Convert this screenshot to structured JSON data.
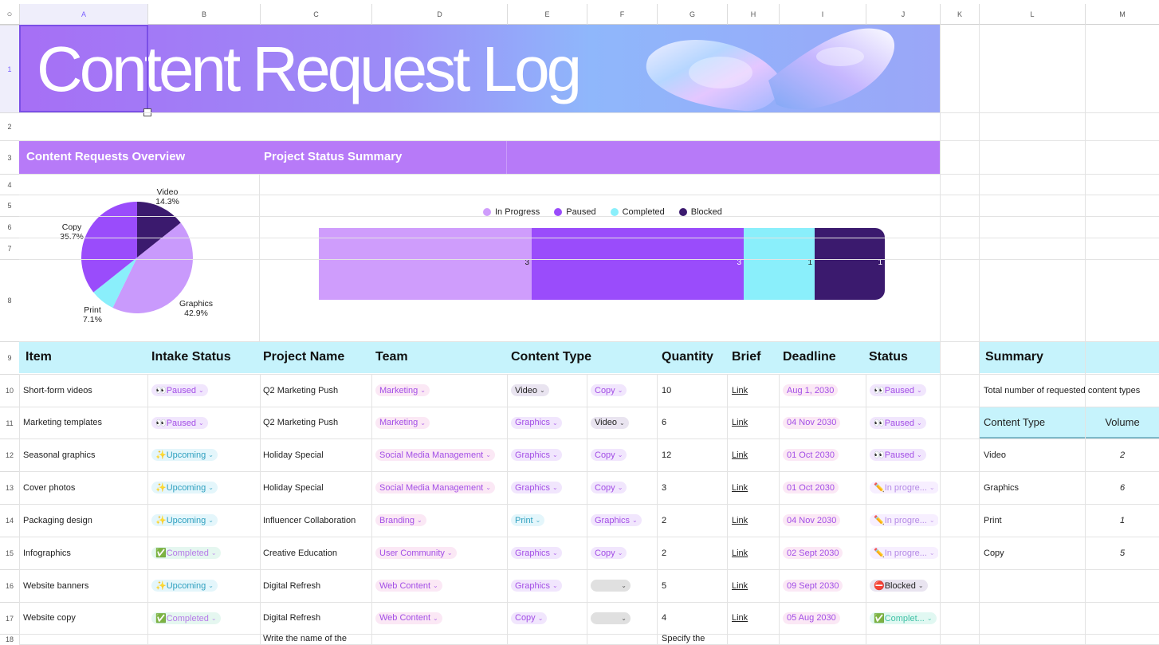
{
  "columns": [
    "A",
    "B",
    "C",
    "D",
    "E",
    "F",
    "G",
    "H",
    "I",
    "J",
    "K",
    "L",
    "M"
  ],
  "rows": [
    "1",
    "2",
    "3",
    "4",
    "5",
    "6",
    "7",
    "8",
    "9",
    "10",
    "11",
    "12",
    "13",
    "14",
    "15",
    "16",
    "17",
    "18"
  ],
  "banner_title": "Content Request Log",
  "sections": {
    "overview": "Content Requests Overview",
    "status_summary": "Project Status Summary"
  },
  "pie": {
    "labels": [
      {
        "name": "Video",
        "pct": "14.3%"
      },
      {
        "name": "Graphics",
        "pct": "42.9%"
      },
      {
        "name": "Print",
        "pct": "7.1%"
      },
      {
        "name": "Copy",
        "pct": "35.7%"
      }
    ]
  },
  "chart_data": {
    "type": "bar",
    "orientation": "horizontal-stacked",
    "series": [
      {
        "name": "In Progress",
        "value": 3,
        "color": "#cf9dfc"
      },
      {
        "name": "Paused",
        "value": 3,
        "color": "#9a4cfb"
      },
      {
        "name": "Completed",
        "value": 1,
        "color": "#8aeffb"
      },
      {
        "name": "Blocked",
        "value": 1,
        "color": "#3b1a6e"
      }
    ],
    "legend": "top",
    "pie": {
      "type": "pie",
      "slices": [
        {
          "name": "Video",
          "value": 14.3,
          "color": "#3b1a6e"
        },
        {
          "name": "Graphics",
          "value": 42.9,
          "color": "#c99afc"
        },
        {
          "name": "Print",
          "value": 7.1,
          "color": "#8aeffb"
        },
        {
          "name": "Copy",
          "value": 35.7,
          "color": "#9a4cfb"
        }
      ]
    }
  },
  "table": {
    "headers": [
      "Item",
      "Intake Status",
      "Project Name",
      "Team",
      "Content Type",
      "Quantity",
      "Brief",
      "Deadline",
      "Status"
    ],
    "rows": [
      {
        "item": "Short-form videos",
        "intake": "👀Paused",
        "intake_k": "purple",
        "project": "Q2 Marketing Push",
        "team": "Marketing",
        "type1": "Video",
        "type1_k": "dark",
        "type2": "Copy",
        "type2_k": "purple",
        "qty": "10",
        "brief": "Link",
        "deadline": "Aug 1, 2030",
        "status": "👀Paused",
        "status_k": "purple"
      },
      {
        "item": "Marketing templates",
        "intake": "👀Paused",
        "intake_k": "purple",
        "project": "Q2 Marketing Push",
        "team": "Marketing",
        "type1": "Graphics",
        "type1_k": "purple",
        "type2": "Video",
        "type2_k": "dark",
        "qty": "6",
        "brief": "Link",
        "deadline": "04 Nov 2030",
        "status": "👀Paused",
        "status_k": "purple"
      },
      {
        "item": "Seasonal graphics",
        "intake": "✨Upcoming",
        "intake_k": "teal",
        "project": "Holiday Special",
        "team": "Social Media Management",
        "type1": "Graphics",
        "type1_k": "purple",
        "type2": "Copy",
        "type2_k": "purple",
        "qty": "12",
        "brief": "Link",
        "deadline": "01 Oct 2030",
        "status": "👀Paused",
        "status_k": "purple"
      },
      {
        "item": "Cover photos",
        "intake": "✨Upcoming",
        "intake_k": "teal",
        "project": "Holiday Special",
        "team": "Social Media Management",
        "type1": "Graphics",
        "type1_k": "purple",
        "type2": "Copy",
        "type2_k": "purple",
        "qty": "3",
        "brief": "Link",
        "deadline": "01 Oct 2030",
        "status": "✏️In progre...",
        "status_k": "inprog"
      },
      {
        "item": "Packaging design",
        "intake": "✨Upcoming",
        "intake_k": "teal",
        "project": "Influencer Collaboration",
        "team": "Branding",
        "type1": "Print",
        "type1_k": "teal",
        "type2": "Graphics",
        "type2_k": "purple",
        "qty": "2",
        "brief": "Link",
        "deadline": "04 Nov 2030",
        "status": "✏️In progre...",
        "status_k": "inprog"
      },
      {
        "item": "Infographics",
        "intake": "✅Completed",
        "intake_k": "green",
        "project": "Creative Education",
        "team": "User Community",
        "type1": "Graphics",
        "type1_k": "purple",
        "type2": "Copy",
        "type2_k": "purple",
        "qty": "2",
        "brief": "Link",
        "deadline": "02 Sept 2030",
        "status": "✏️In progre...",
        "status_k": "inprog"
      },
      {
        "item": "Website banners",
        "intake": "✨Upcoming",
        "intake_k": "teal",
        "project": "Digital Refresh",
        "team": "Web Content",
        "type1": "Graphics",
        "type1_k": "purple",
        "type2": "",
        "type2_k": "blank",
        "qty": "5",
        "brief": "Link",
        "deadline": "09 Sept 2030",
        "status": "⛔Blocked",
        "status_k": "dark"
      },
      {
        "item": "Website copy",
        "intake": "✅Completed",
        "intake_k": "green",
        "project": "Digital Refresh",
        "team": "Web Content",
        "type1": "Copy",
        "type1_k": "purple",
        "type2": "",
        "type2_k": "blank",
        "qty": "4",
        "brief": "Link",
        "deadline": "05 Aug 2030",
        "status": "✅Complet...",
        "status_k": "done"
      }
    ],
    "partial_row": {
      "project": "Write the name of the",
      "qty": "Specify the"
    }
  },
  "summary": {
    "title": "Summary",
    "note": "Total number of requested content types",
    "col_type": "Content Type",
    "col_volume": "Volume",
    "items": [
      {
        "type": "Video",
        "volume": "2"
      },
      {
        "type": "Graphics",
        "volume": "6"
      },
      {
        "type": "Print",
        "volume": "1"
      },
      {
        "type": "Copy",
        "volume": "5"
      }
    ]
  },
  "corner_symbol": "○"
}
